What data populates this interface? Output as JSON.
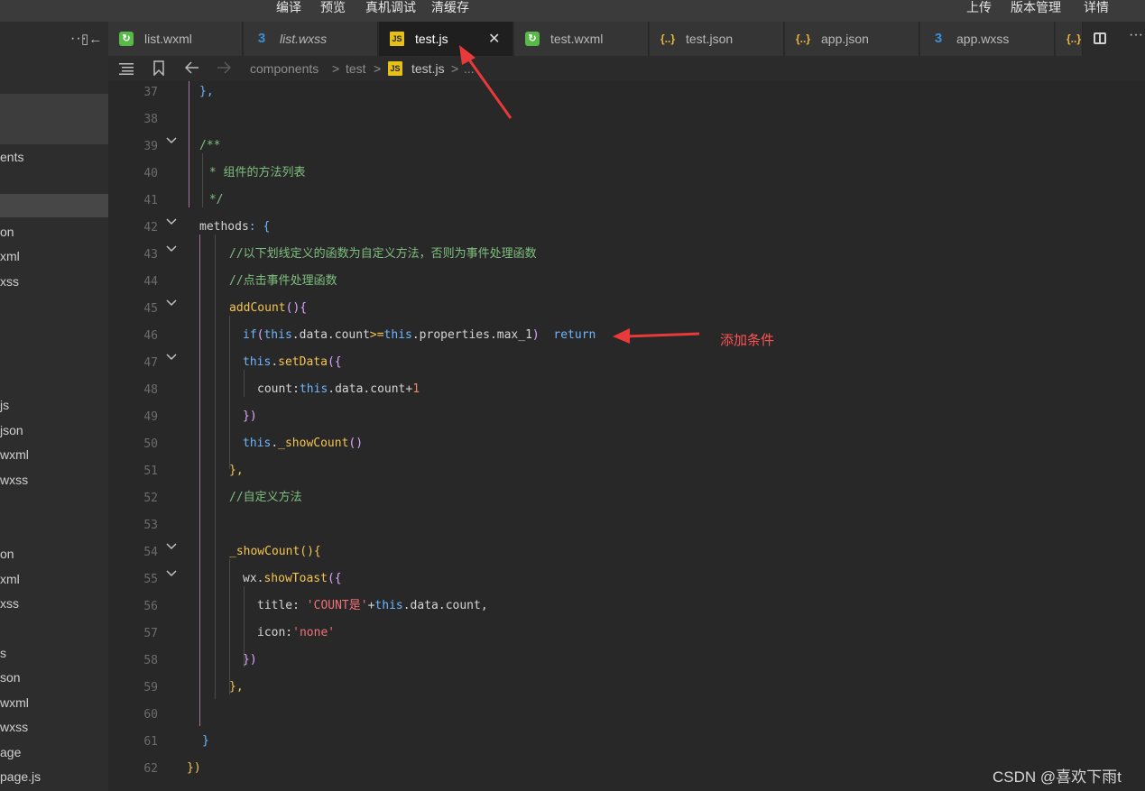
{
  "topbar": {
    "compile": "编译",
    "preview": "预览",
    "device_debug": "真机调试",
    "clear_cache": "清缓存",
    "upload": "上传",
    "version": "版本管理",
    "details": "详情"
  },
  "sidebar": {
    "more": "···",
    "items": [
      "ents",
      "on",
      "xml",
      "xss",
      "js",
      "json",
      "wxml",
      "wxss",
      "on",
      "xml",
      "xss",
      "s",
      "son",
      "wxml",
      "wxss",
      "age",
      "page.js"
    ]
  },
  "tabs": [
    {
      "label": "list.wxml",
      "icon": "wxml-file-icon",
      "active": false
    },
    {
      "label": "list.wxss",
      "icon": "css-file-icon",
      "active": false
    },
    {
      "label": "test.js",
      "icon": "js-file-icon",
      "active": true,
      "close": "✕"
    },
    {
      "label": "test.wxml",
      "icon": "wxml-file-icon",
      "active": false
    },
    {
      "label": "test.json",
      "icon": "json-file-icon",
      "active": false
    },
    {
      "label": "app.json",
      "icon": "json-file-icon",
      "active": false
    },
    {
      "label": "app.wxss",
      "icon": "css-file-icon",
      "active": false
    }
  ],
  "tab_icons": {
    "js": "JS",
    "wxml": "↻",
    "css": "3",
    "json": "{..}"
  },
  "breadcrumb": {
    "root": "components",
    "folder": "test",
    "file": "test.js",
    "sep": ">",
    "tail": "..."
  },
  "code": {
    "line_numbers": [
      "37",
      "38",
      "39",
      "40",
      "41",
      "42",
      "43",
      "44",
      "45",
      "46",
      "47",
      "48",
      "49",
      "50",
      "51",
      "52",
      "53",
      "54",
      "55",
      "56",
      "57",
      "58",
      "59",
      "60",
      "61",
      "62"
    ],
    "l37": "},",
    "l39": "/**",
    "l40": " * 组件的方法列表",
    "l41": " */",
    "l42a": "methods",
    "l42b": ": {",
    "l43": "//以下划线定义的函数为自定义方法，否则为事件处理函数",
    "l44": "//点击事件处理函数",
    "l45a": "addCount",
    "l45b": "(){",
    "l46a": "if",
    "l46b": "(",
    "l46c": "this",
    "l46d": ".data.count",
    "l46e": ">=",
    "l46f": "this",
    "l46g": ".properties.max_1",
    "l46h": ")  ",
    "l46i": "return",
    "l47a": "this",
    "l47b": ".",
    "l47c": "setData",
    "l47d": "({",
    "l48a": "count:",
    "l48b": "this",
    "l48c": ".data.count+",
    "l48d": "1",
    "l49": "})",
    "l50a": "this",
    "l50b": ".",
    "l50c": "_showCount",
    "l50d": "()",
    "l51": "},",
    "l52": "//自定义方法",
    "l54a": "_showCount",
    "l54b": "(){",
    "l55a": "wx.",
    "l55b": "showToast",
    "l55c": "({",
    "l56a": "title: ",
    "l56b": "'COUNT是'",
    "l56c": "+",
    "l56d": "this",
    "l56e": ".data.count,",
    "l57a": "icon:",
    "l57b": "'none'",
    "l58": "})",
    "l59": "},",
    "l61": "}",
    "l62": "})"
  },
  "annotation": {
    "label": "添加条件",
    "color": "#ff3b3b"
  },
  "watermark": "CSDN @喜欢下雨t"
}
